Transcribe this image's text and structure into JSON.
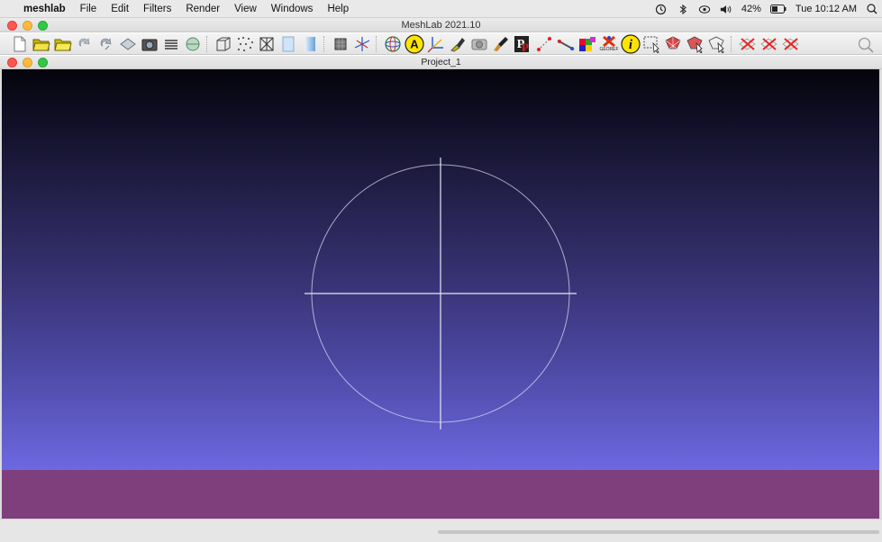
{
  "menubar": {
    "app_name": "meshlab",
    "items": [
      "File",
      "Edit",
      "Filters",
      "Render",
      "View",
      "Windows",
      "Help"
    ],
    "battery": "42%",
    "clock": "Tue 10:12 AM"
  },
  "window": {
    "title": "MeshLab 2021.10"
  },
  "document": {
    "title": "Project_1"
  },
  "toolbar": {
    "georef_label": "GEOREF",
    "icons": [
      "new-icon",
      "open-icon",
      "open-project-icon",
      "reload-icon",
      "reload-all-icon",
      "save-icon",
      "snapshot-icon",
      "layers-icon",
      "import-raster-icon",
      "bbox-icon",
      "points-icon",
      "wireframe-icon",
      "flat-icon",
      "smooth-icon",
      "texture-icon",
      "axis-icon",
      "trackball-icon",
      "annotation-icon",
      "light-icon",
      "paint-icon",
      "camera-icon",
      "brush-icon",
      "pickpoints-icon",
      "align-icon",
      "measure-icon",
      "color-icon",
      "georef-icon",
      "info-icon",
      "select-icon",
      "select-faces-icon",
      "select-vertices-icon",
      "select-connected-icon",
      "delete-faces-icon",
      "delete-vertices-icon",
      "delete-all-icon",
      "search-icon"
    ]
  },
  "colors": {
    "viewport_top": "#04040c",
    "viewport_bottom": "#6d68e0",
    "floor": "#7f3f7d",
    "trackball": "#d8d8f0"
  }
}
